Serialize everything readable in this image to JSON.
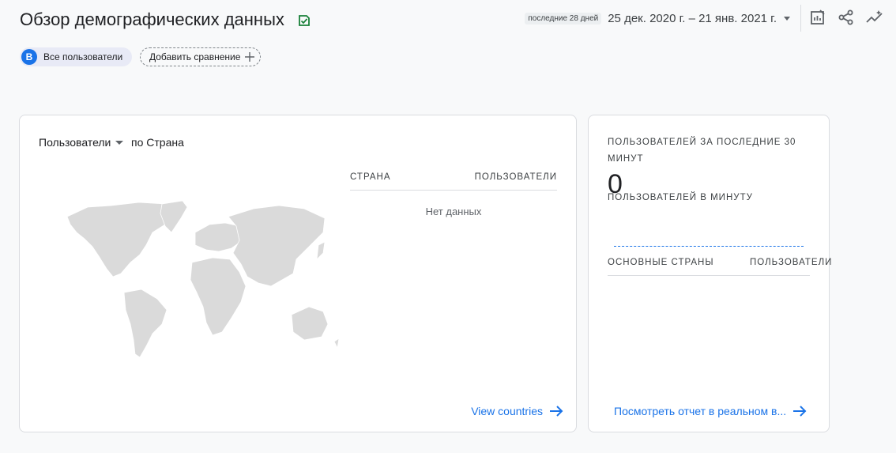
{
  "header": {
    "title": "Обзор демографических данных",
    "date_range_badge": "последние 28 дней",
    "date_range": "25 дек. 2020 г. – 21 янв. 2021 г."
  },
  "toolbar": {
    "icons": [
      "customize-report-icon",
      "share-icon",
      "insights-icon"
    ]
  },
  "comparison": {
    "segment_avatar": "В",
    "segment_label": "Все пользователи",
    "add_comparison_label": "Добавить сравнение"
  },
  "map_card": {
    "metric_label": "Пользователи",
    "dimension_label": "по Страна",
    "table": {
      "col_country": "СТРАНА",
      "col_users": "ПОЛЬЗОВАТЕЛИ",
      "empty_text": "Нет данных"
    },
    "link_label": "View countries"
  },
  "realtime_card": {
    "title": "ПОЛЬЗОВАТЕЛЕЙ ЗА ПОСЛЕДНИЕ 30 МИНУТ",
    "value": "0",
    "subtitle": "ПОЛЬЗОВАТЕЛЕЙ В МИНУТУ",
    "table": {
      "col_countries": "ОСНОВНЫЕ СТРАНЫ",
      "col_users": "ПОЛЬЗОВАТЕЛИ"
    },
    "link_label": "Посмотреть отчет в реальном в..."
  },
  "colors": {
    "accent": "#1a73e8",
    "check_green": "#188038",
    "map_fill": "#dadada"
  }
}
